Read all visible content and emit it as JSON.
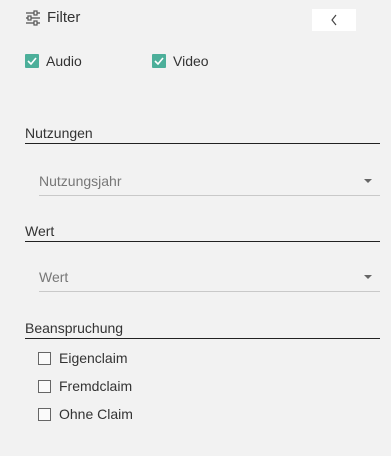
{
  "header": {
    "icon": "sliders-icon",
    "title": "Filter",
    "collapse_icon": "chevron-left-icon"
  },
  "media": [
    {
      "label": "Audio",
      "checked": true
    },
    {
      "label": "Video",
      "checked": true
    }
  ],
  "sections": {
    "usage": {
      "title": "Nutzungen",
      "select_value": "Nutzungsjahr"
    },
    "value": {
      "title": "Wert",
      "select_value": "Wert"
    },
    "claim": {
      "title": "Beanspruchung",
      "options": [
        {
          "label": "Eigenclaim",
          "checked": false
        },
        {
          "label": "Fremdclaim",
          "checked": false
        },
        {
          "label": "Ohne Claim",
          "checked": false
        }
      ]
    }
  },
  "colors": {
    "background": "#f2f2f2",
    "checkbox_checked": "#4caf9a",
    "text": "#333333",
    "placeholder_text": "#777777"
  }
}
